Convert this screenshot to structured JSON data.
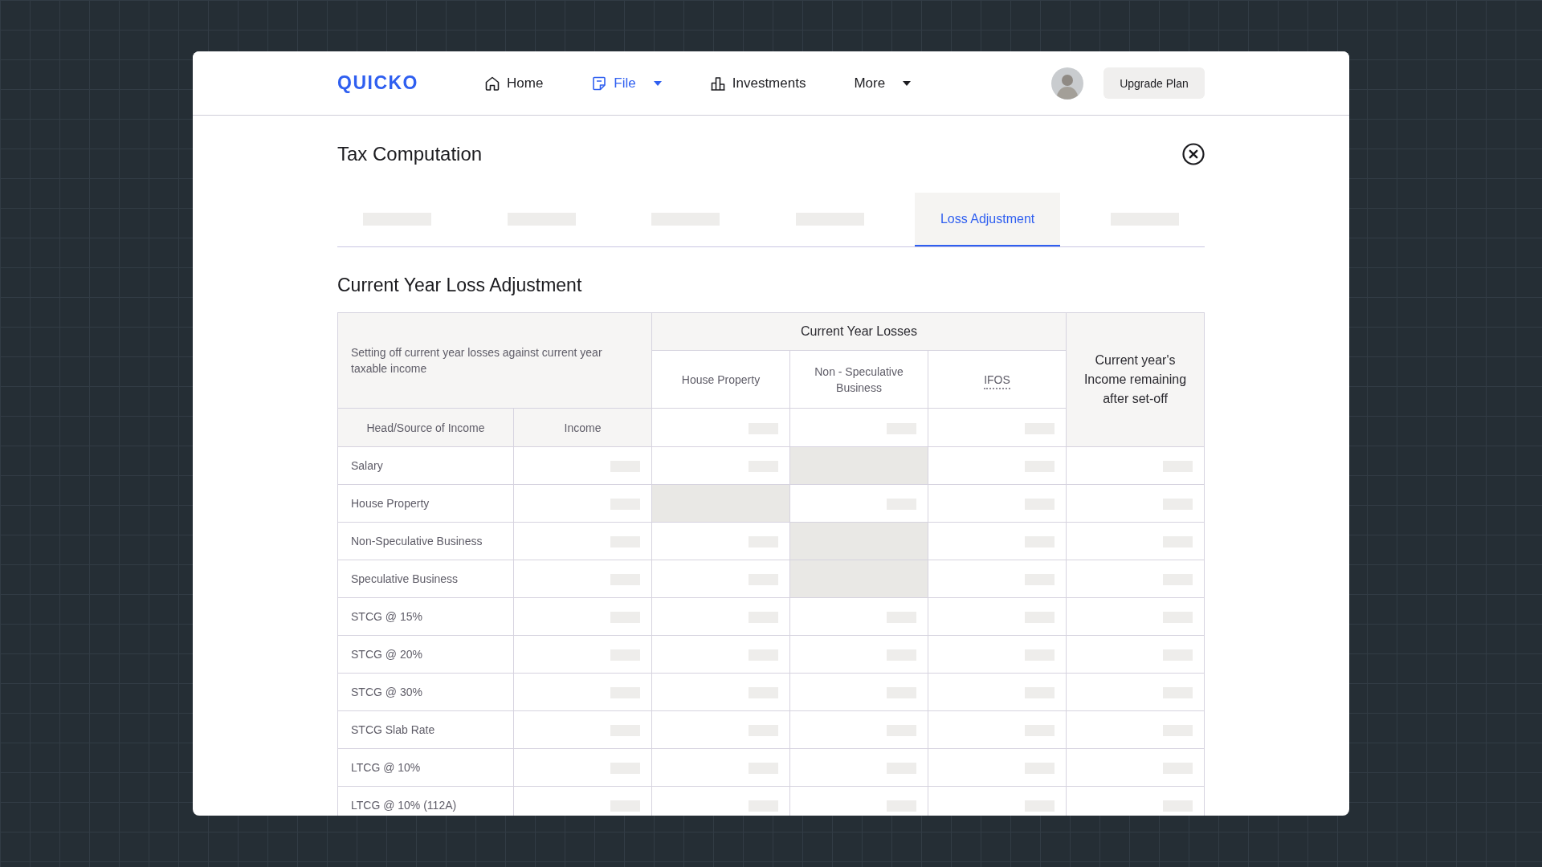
{
  "logo": {
    "text": "QUICKO"
  },
  "nav": [
    {
      "label": "Home",
      "selected": false,
      "dropdown": false
    },
    {
      "label": "File",
      "selected": true,
      "dropdown": true
    },
    {
      "label": "Investments",
      "selected": false,
      "dropdown": false
    },
    {
      "label": "More",
      "selected": false,
      "dropdown": true
    }
  ],
  "upgrade_button": {
    "label": "Upgrade Plan"
  },
  "dialog": {
    "title": "Tax Computation"
  },
  "tabs": [
    {
      "kind": "skeleton",
      "selected": false
    },
    {
      "kind": "skeleton",
      "selected": false
    },
    {
      "kind": "skeleton",
      "selected": false
    },
    {
      "kind": "skeleton",
      "selected": false
    },
    {
      "kind": "text",
      "label": "Loss Adjustment",
      "selected": true
    },
    {
      "kind": "skeleton",
      "selected": false
    }
  ],
  "section": {
    "title": "Current Year Loss Adjustment"
  },
  "table": {
    "intro": "Setting off current year losses against current year taxable income",
    "group_header": "Current Year Losses",
    "loss_columns": [
      {
        "label": "House Property",
        "tooltip": false
      },
      {
        "label": "Non - Speculative Business",
        "tooltip": false
      },
      {
        "label": "IFOS",
        "tooltip": true
      }
    ],
    "remaining_header": "Current year's Income remaining after set-off",
    "row_headers": [
      "Head/Source of Income",
      "Income"
    ],
    "rows": [
      {
        "label": "Salary",
        "loss_cells": [
          {
            "disabled": false
          },
          {
            "disabled": true
          },
          {
            "disabled": false
          }
        ]
      },
      {
        "label": "House Property",
        "loss_cells": [
          {
            "disabled": true
          },
          {
            "disabled": false
          },
          {
            "disabled": false
          }
        ]
      },
      {
        "label": "Non-Speculative Business",
        "loss_cells": [
          {
            "disabled": false
          },
          {
            "disabled": true
          },
          {
            "disabled": false
          }
        ]
      },
      {
        "label": "Speculative Business",
        "loss_cells": [
          {
            "disabled": false
          },
          {
            "disabled": true
          },
          {
            "disabled": false
          }
        ]
      },
      {
        "label": "STCG @ 15%",
        "loss_cells": [
          {
            "disabled": false
          },
          {
            "disabled": false
          },
          {
            "disabled": false
          }
        ]
      },
      {
        "label": "STCG @ 20%",
        "loss_cells": [
          {
            "disabled": false
          },
          {
            "disabled": false
          },
          {
            "disabled": false
          }
        ]
      },
      {
        "label": "STCG @ 30%",
        "loss_cells": [
          {
            "disabled": false
          },
          {
            "disabled": false
          },
          {
            "disabled": false
          }
        ]
      },
      {
        "label": "STCG Slab Rate",
        "loss_cells": [
          {
            "disabled": false
          },
          {
            "disabled": false
          },
          {
            "disabled": false
          }
        ]
      },
      {
        "label": "LTCG @ 10%",
        "loss_cells": [
          {
            "disabled": false
          },
          {
            "disabled": false
          },
          {
            "disabled": false
          }
        ]
      },
      {
        "label": "LTCG @ 10% (112A)",
        "loss_cells": [
          {
            "disabled": false
          },
          {
            "disabled": false
          },
          {
            "disabled": false
          }
        ]
      }
    ]
  }
}
